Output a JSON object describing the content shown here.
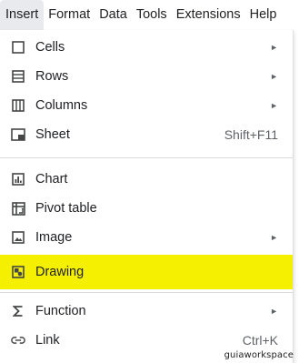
{
  "menubar": {
    "items": [
      {
        "label": "Insert"
      },
      {
        "label": "Format"
      },
      {
        "label": "Data"
      },
      {
        "label": "Tools"
      },
      {
        "label": "Extensions"
      },
      {
        "label": "Help"
      }
    ]
  },
  "insert_menu": {
    "items": [
      {
        "label": "Cells",
        "icon": "square-outline-icon",
        "submenu_arrow": "►"
      },
      {
        "label": "Rows",
        "icon": "rows-icon",
        "submenu_arrow": "►"
      },
      {
        "label": "Columns",
        "icon": "columns-icon",
        "submenu_arrow": "►"
      },
      {
        "label": "Sheet",
        "icon": "sheet-icon",
        "shortcut": "Shift+F11"
      },
      {
        "label": "Chart",
        "icon": "chart-icon"
      },
      {
        "label": "Pivot table",
        "icon": "pivot-table-icon"
      },
      {
        "label": "Image",
        "icon": "image-icon",
        "submenu_arrow": "►"
      },
      {
        "label": "Drawing",
        "icon": "drawing-icon",
        "highlighted": true
      },
      {
        "label": "Function",
        "icon": "sigma-icon",
        "submenu_arrow": "►"
      },
      {
        "label": "Link",
        "icon": "link-icon",
        "shortcut": "Ctrl+K"
      }
    ]
  },
  "colors": {
    "highlight": "#f5f002",
    "active_menu_bg": "#e8eaed",
    "icon": "#444746"
  },
  "watermark": "guiaworkspace"
}
